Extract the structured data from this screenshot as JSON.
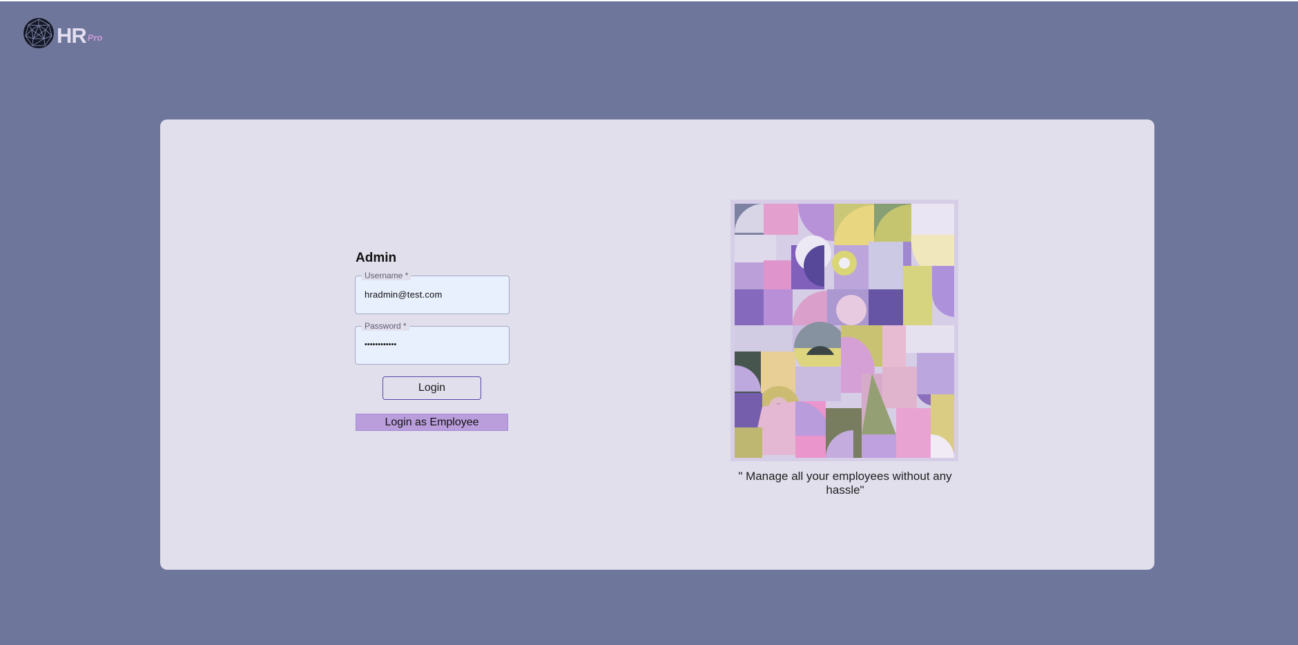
{
  "logo": {
    "icon": "geodesic-globe-icon",
    "text": "HR",
    "suffix": "Pro"
  },
  "login_form": {
    "title": "Admin",
    "username": {
      "label": "Username *",
      "value": "hradmin@test.com"
    },
    "password": {
      "label": "Password *",
      "value": "••••••••••••"
    },
    "login_button": "Login",
    "employee_button": "Login as Employee"
  },
  "hero": {
    "image": "abstract-geometric-artwork",
    "tagline": "\" Manage all your employees without any hassle\""
  },
  "colors": {
    "page_background": "#6f769b",
    "card_background": "#e2dfed",
    "input_background": "#e8effd",
    "login_button_border": "#5744a6",
    "employee_button_background": "#b99edb",
    "logo_text": "#e3dff0",
    "logo_pro": "#c89bd8"
  }
}
